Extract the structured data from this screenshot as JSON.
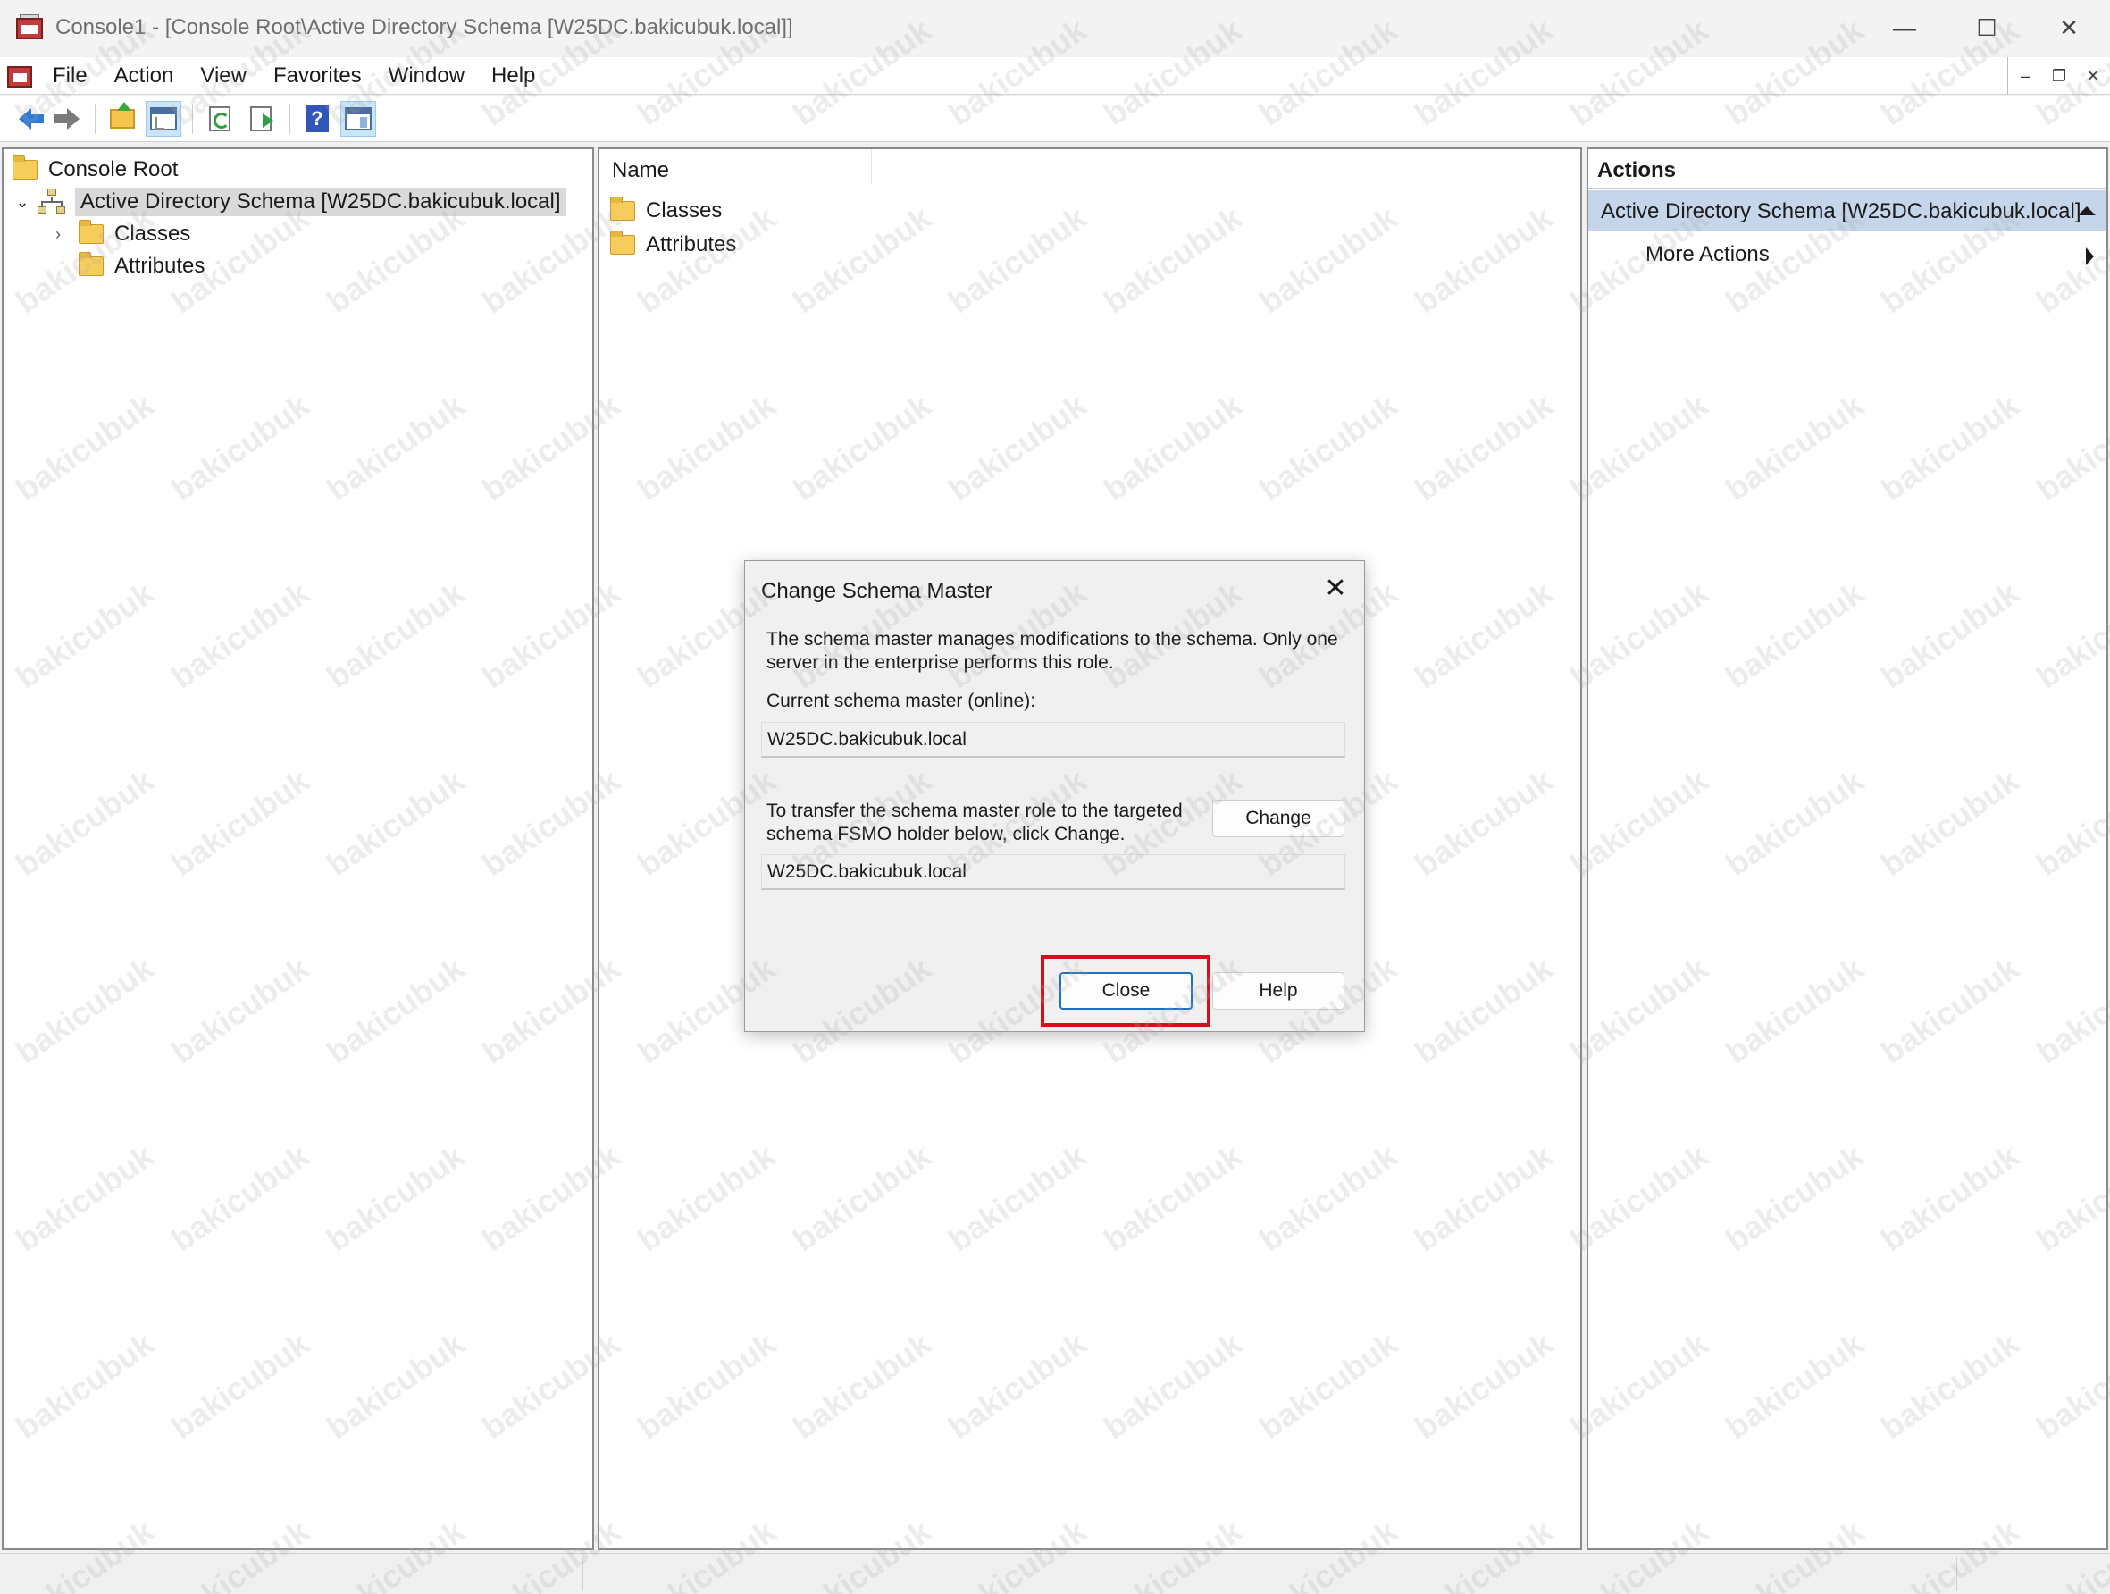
{
  "window": {
    "title": "Console1 - [Console Root\\Active Directory Schema [W25DC.bakicubuk.local]]",
    "minimize": "—",
    "maximize": "☐",
    "close": "✕"
  },
  "menubar": {
    "items": [
      "File",
      "Action",
      "View",
      "Favorites",
      "Window",
      "Help"
    ],
    "mdi_minimize": "–",
    "mdi_restore": "❐",
    "mdi_close": "✕"
  },
  "toolbar": {
    "icons": [
      "back-arrow-icon",
      "forward-arrow-icon",
      "up-one-level-icon",
      "show-hide-console-tree-icon",
      "refresh-icon",
      "export-list-icon",
      "help-icon",
      "show-hide-action-pane-icon"
    ]
  },
  "tree": {
    "root": "Console Root",
    "snapin": "Active Directory Schema [W25DC.bakicubuk.local]",
    "children": [
      "Classes",
      "Attributes"
    ],
    "expand_icon": "⌄",
    "collapse_icon": "›"
  },
  "list": {
    "column_name": "Name",
    "items": [
      "Classes",
      "Attributes"
    ]
  },
  "actions": {
    "header": "Actions",
    "section": "Active Directory Schema [W25DC.bakicubuk.local]",
    "more": "More Actions"
  },
  "dialog": {
    "title": "Change Schema Master",
    "close_glyph": "✕",
    "description_line1": "The schema master manages modifications to the schema. Only one",
    "description_line2": "server in the enterprise performs this role.",
    "current_label": "Current schema master (online):",
    "current_value": "W25DC.bakicubuk.local",
    "transfer_line1": "To transfer the schema master role to the targeted",
    "transfer_line2": "schema FSMO holder below, click Change.",
    "target_value": "W25DC.bakicubuk.local",
    "change_button": "Change",
    "close_button": "Close",
    "help_button": "Help"
  },
  "watermark": "bakicubuk",
  "colors": {
    "selection": "#c5d6ea",
    "highlight": "#d0121b",
    "default_button_border": "#1f6fbf"
  }
}
